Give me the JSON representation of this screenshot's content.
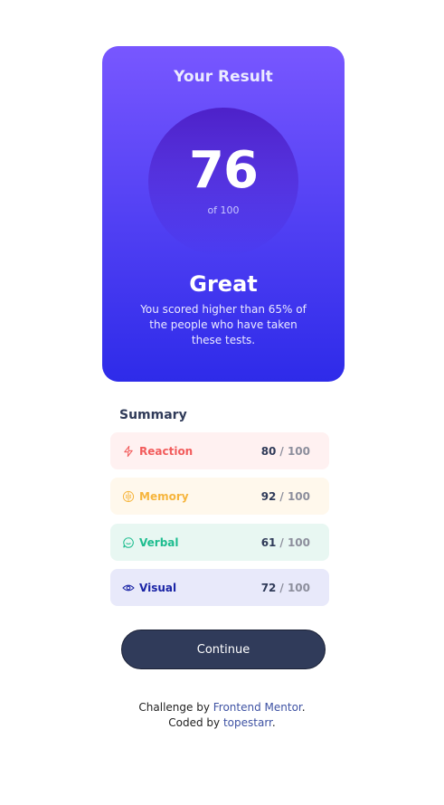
{
  "result": {
    "title": "Your Result",
    "score": "76",
    "score_of": "of 100",
    "grade": "Great",
    "description": "You scored higher than 65% of the people who have taken these tests."
  },
  "summary": {
    "title": "Summary",
    "items": [
      {
        "label": "Reaction",
        "score": "80",
        "total": "/ 100",
        "icon": "lightning-icon",
        "color": "#f25c5c",
        "bg": "#fff1f1"
      },
      {
        "label": "Memory",
        "score": "92",
        "total": "/ 100",
        "icon": "brain-icon",
        "color": "#f6b53d",
        "bg": "#fff8ec"
      },
      {
        "label": "Verbal",
        "score": "61",
        "total": "/ 100",
        "icon": "chat-bubble-icon",
        "color": "#1dbd8f",
        "bg": "#e8f7f2"
      },
      {
        "label": "Visual",
        "score": "72",
        "total": "/ 100",
        "icon": "eye-icon",
        "color": "#1b25a6",
        "bg": "#e8e9fa"
      }
    ]
  },
  "actions": {
    "continue_label": "Continue"
  },
  "attribution": {
    "challenge_prefix": "Challenge by",
    "challenge_link": "Frontend Mentor",
    "coded_prefix": "Coded by",
    "coded_link": "topestarr",
    "suffix": "."
  }
}
